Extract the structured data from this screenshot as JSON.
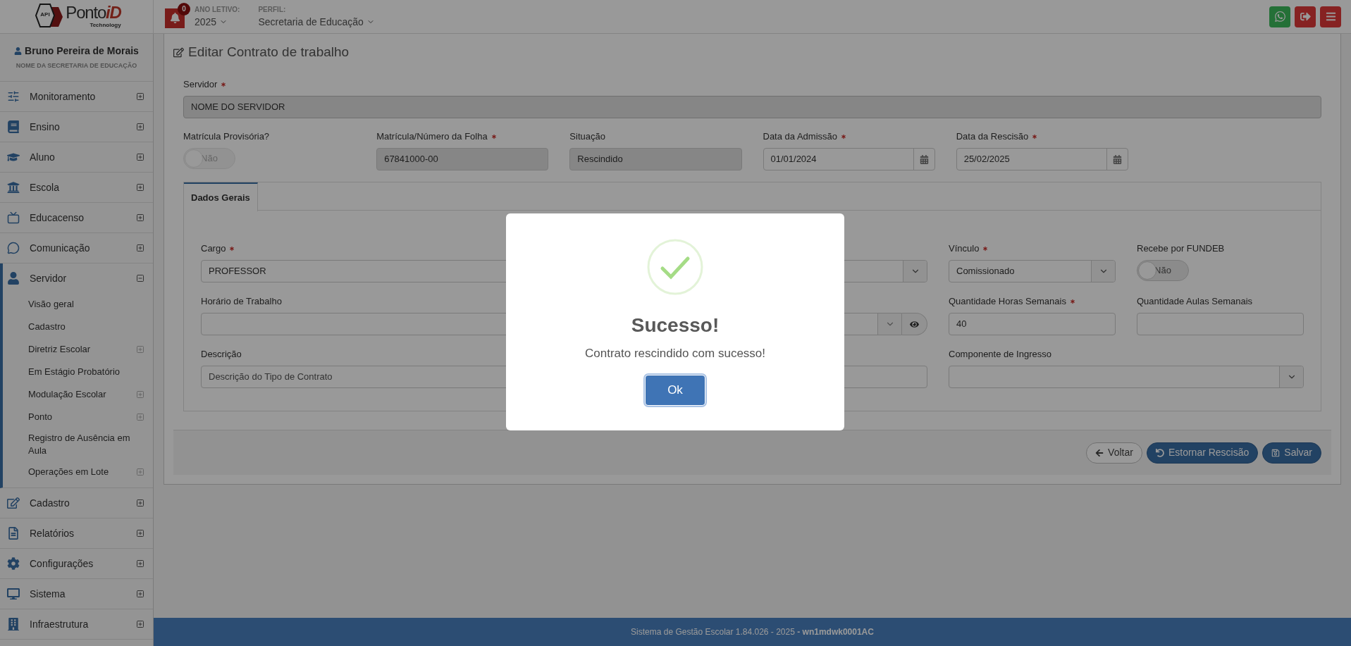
{
  "header": {
    "logo": {
      "badge": "API",
      "name": "Ponto",
      "accent": "iD",
      "tagline": "Technology"
    },
    "notifications": {
      "count": "0"
    },
    "school_year": {
      "label": "ANO LETIVO:",
      "value": "2025"
    },
    "profile": {
      "label": "PERFIL:",
      "value": "Secretaria de Educação"
    }
  },
  "user": {
    "name": "Bruno Pereira de Morais",
    "organization": "NOME DA SECRETARIA DE EDUCAÇÃO"
  },
  "sidebar": {
    "items": [
      {
        "label": "Monitoramento",
        "expanded": false
      },
      {
        "label": "Ensino",
        "expanded": false
      },
      {
        "label": "Aluno",
        "expanded": false
      },
      {
        "label": "Escola",
        "expanded": false
      },
      {
        "label": "Educacenso",
        "expanded": false
      },
      {
        "label": "Comunicação",
        "expanded": false
      },
      {
        "label": "Servidor",
        "expanded": true,
        "children": [
          {
            "label": "Visão geral",
            "expandable": false
          },
          {
            "label": "Cadastro",
            "expandable": false
          },
          {
            "label": "Diretriz Escolar",
            "expandable": true
          },
          {
            "label": "Em Estágio Probatório",
            "expandable": false
          },
          {
            "label": "Modulação Escolar",
            "expandable": true
          },
          {
            "label": "Ponto",
            "expandable": true
          },
          {
            "label": "Registro de Ausência em Aula",
            "expandable": false
          },
          {
            "label": "Operações em Lote",
            "expandable": true
          }
        ]
      },
      {
        "label": "Cadastro",
        "expanded": false
      },
      {
        "label": "Relatórios",
        "expanded": false
      },
      {
        "label": "Configurações",
        "expanded": false
      },
      {
        "label": "Sistema",
        "expanded": false
      },
      {
        "label": "Infraestrutura",
        "expanded": false
      }
    ]
  },
  "page": {
    "title": "Editar Contrato de trabalho"
  },
  "form": {
    "servidor": {
      "label": "Servidor",
      "required": true,
      "value": "NOME DO SERVIDOR",
      "disabled": true
    },
    "row": [
      {
        "kind": "toggle",
        "label": "Matrícula Provisória?",
        "disabled": true,
        "toggle": {
          "label": "Não",
          "on": false
        }
      },
      {
        "kind": "text",
        "label": "Matrícula/Número da Folha",
        "required": true,
        "disabled": true,
        "value": "67841000-00"
      },
      {
        "kind": "text",
        "label": "Situação",
        "disabled": true,
        "value": "Rescindido"
      },
      {
        "kind": "date",
        "label": "Data da Admissão",
        "required": true,
        "disabled": false,
        "value": "01/01/2024"
      },
      {
        "kind": "date",
        "label": "Data da Rescisão",
        "required": true,
        "disabled": false,
        "value": "25/02/2025"
      }
    ]
  },
  "tabs": [
    {
      "label": "Dados Gerais",
      "selected": true
    }
  ],
  "tab_rows": [
    [
      {
        "kind": "select",
        "label": "Cargo",
        "required": true,
        "value": "PROFESSOR"
      },
      {
        "kind": "select",
        "label": "Vínculo",
        "required": true,
        "value": "Comissionado"
      },
      {
        "kind": "toggle",
        "label": "Recebe por FUNDEB",
        "toggle": {
          "label": "Não",
          "on": false
        }
      }
    ],
    [
      {
        "kind": "select-view",
        "label": "Horário de Trabalho"
      },
      {
        "kind": "text",
        "label": "Quantidade Horas Semanais",
        "required": true,
        "value": "40"
      },
      {
        "kind": "text",
        "label": "Quantidade Aulas Semanais"
      }
    ],
    [
      {
        "kind": "text",
        "label": "Descrição",
        "placeholder": "Descrição do Tipo de Contrato"
      },
      {
        "kind": "select",
        "label": "Componente de Ingresso"
      }
    ]
  ],
  "actions": [
    {
      "kind": "back",
      "label": "Voltar"
    },
    {
      "kind": "undo",
      "label": "Estornar Rescisão"
    },
    {
      "kind": "save",
      "label": "Salvar"
    }
  ],
  "footer": {
    "text": "Sistema de Gestão Escolar 1.84.026 - 2025 **- wn1mdwk0001AC**"
  },
  "dialog": {
    "title": "Sucesso!",
    "message": "Contrato rescindido com sucesso!",
    "button": "Ok"
  }
}
